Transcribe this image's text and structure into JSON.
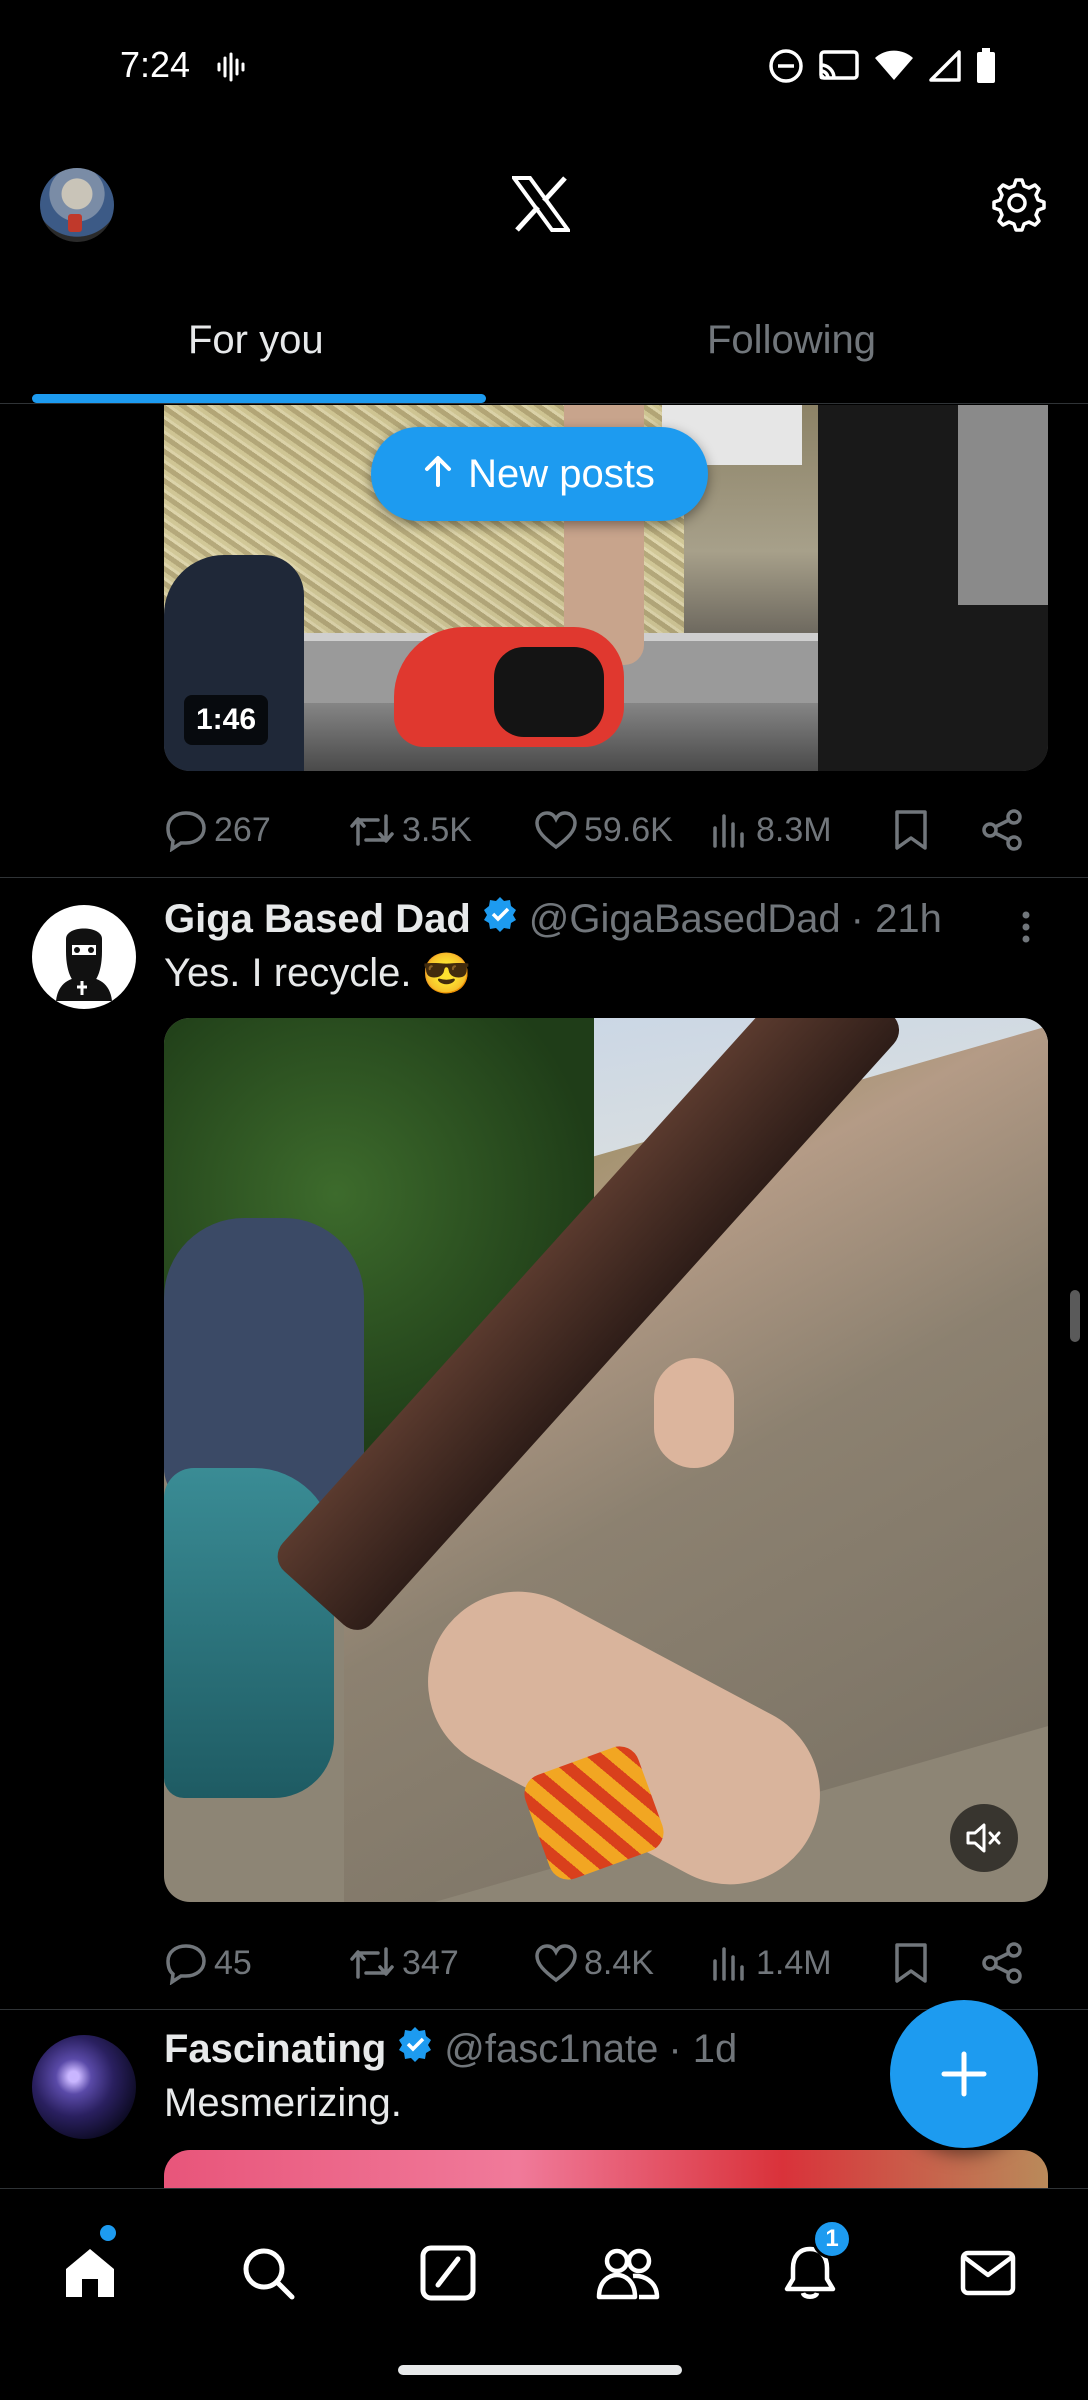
{
  "status": {
    "time": "7:24"
  },
  "tabs": {
    "for_you": "For you",
    "following": "Following"
  },
  "new_posts": {
    "label": "New posts"
  },
  "posts": [
    {
      "media": {
        "duration": "1:46"
      },
      "stats": {
        "replies": "267",
        "reposts": "3.5K",
        "likes": "59.6K",
        "views": "8.3M"
      }
    },
    {
      "author": "Giga Based Dad",
      "handle": "@GigaBasedDad",
      "time": "· 21h",
      "verified": true,
      "text": "Yes. I recycle.",
      "emoji": "😎",
      "stats": {
        "replies": "45",
        "reposts": "347",
        "likes": "8.4K",
        "views": "1.4M"
      }
    },
    {
      "author": "Fascinating",
      "handle": "@fasc1nate",
      "time": "· 1d",
      "verified": true,
      "text": "Mesmerizing."
    }
  ],
  "nav": {
    "notifications_badge": "1"
  },
  "colors": {
    "accent": "#1d9bf0",
    "background": "#000000",
    "muted": "#71767b"
  }
}
